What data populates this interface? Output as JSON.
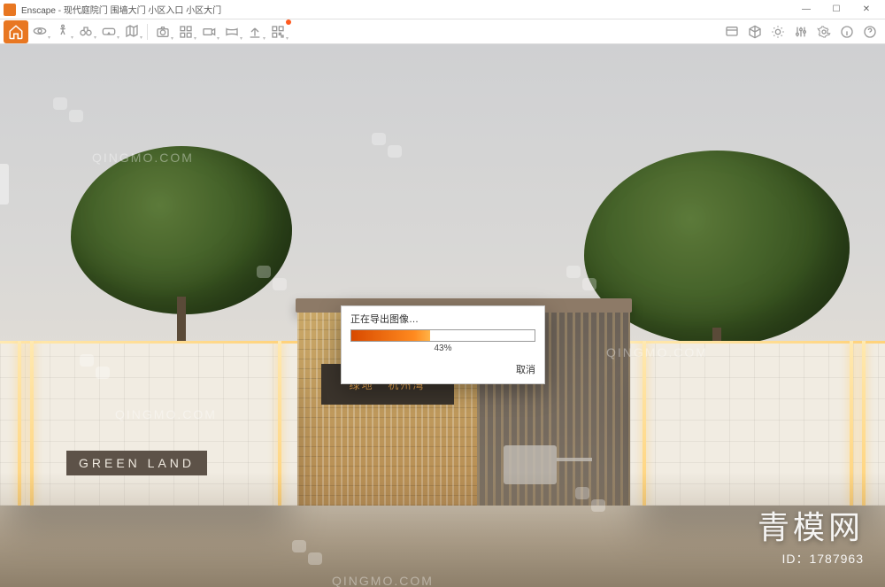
{
  "app": {
    "name": "Enscape",
    "title_suffix": "现代庭院门 围墙大门 小区入口 小区大门"
  },
  "window_controls": {
    "min": "—",
    "max": "☐",
    "close": "✕"
  },
  "toolbar": {
    "left": [
      {
        "name": "home-icon",
        "glyph": "home"
      },
      {
        "name": "orbit-icon",
        "glyph": "orbit"
      },
      {
        "name": "walk-icon",
        "glyph": "walk"
      },
      {
        "name": "binoculars-icon",
        "glyph": "bino"
      },
      {
        "name": "vr-icon",
        "glyph": "vr"
      },
      {
        "name": "map-icon",
        "glyph": "map"
      }
    ],
    "mid": [
      {
        "name": "screenshot-icon",
        "glyph": "camera"
      },
      {
        "name": "batch-icon",
        "glyph": "grid"
      },
      {
        "name": "video-icon",
        "glyph": "film"
      },
      {
        "name": "mono-pano-icon",
        "glyph": "pano"
      },
      {
        "name": "export-icon",
        "glyph": "up"
      },
      {
        "name": "qr-icon",
        "glyph": "qr",
        "badge": true
      }
    ],
    "right": [
      {
        "name": "views-icon",
        "glyph": "views"
      },
      {
        "name": "assets-icon",
        "glyph": "assets"
      },
      {
        "name": "sun-icon",
        "glyph": "sun"
      },
      {
        "name": "visual-settings-icon",
        "glyph": "sliders"
      },
      {
        "name": "settings-icon",
        "glyph": "gear"
      },
      {
        "name": "info-icon",
        "glyph": "info"
      },
      {
        "name": "help-icon",
        "glyph": "help"
      }
    ]
  },
  "dialog": {
    "title": "正在导出图像…",
    "percent_label": "43%",
    "percent_value": 43,
    "cancel": "取消"
  },
  "scene": {
    "wall_sign": "GREEN LAND",
    "gate_sign_left": "绿地",
    "gate_sign_right": "杭州湾"
  },
  "watermark": {
    "text": "QINGMO.COM",
    "brand_cn": "青模网",
    "id_label": "ID：1787963"
  }
}
